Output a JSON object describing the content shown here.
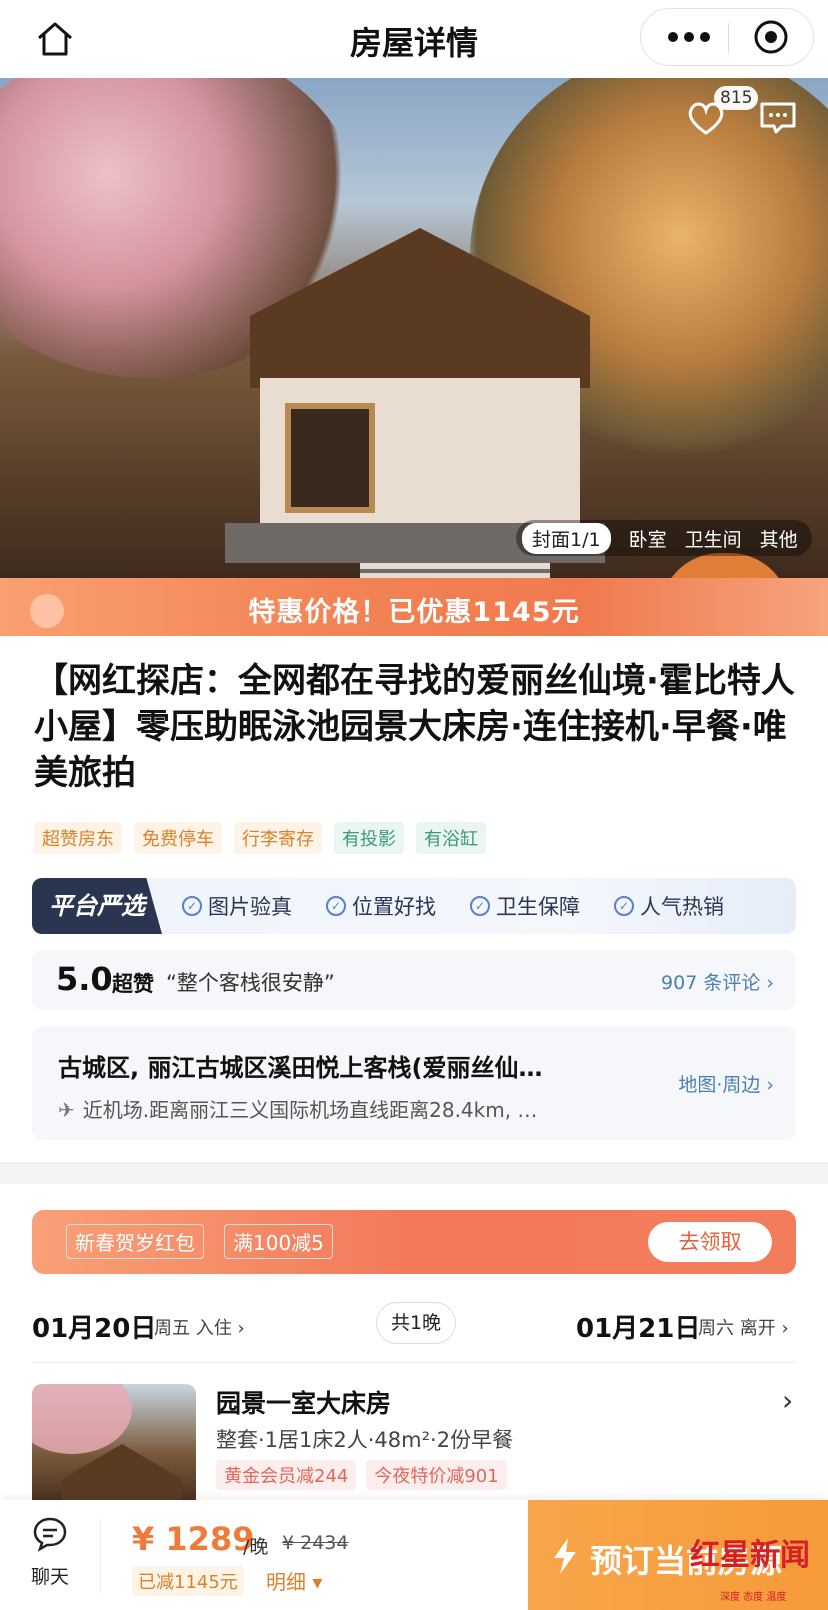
{
  "header": {
    "title": "房屋详情"
  },
  "hero": {
    "favorite_count": "815",
    "image_tabs": [
      "封面1/1",
      "卧室",
      "卫生间",
      "其他"
    ]
  },
  "promo": {
    "text": "特惠价格！已优惠1145元"
  },
  "listing": {
    "title": "【网红探店：全网都在寻找的爱丽丝仙境·霍比特人小屋】零压助眠泳池园景大床房·连住接机·早餐·唯美旅拍",
    "tags": [
      "超赞房东",
      "免费停车",
      "行李寄存",
      "有投影",
      "有浴缸"
    ]
  },
  "platform": {
    "logo": "平台严选",
    "items": [
      "图片验真",
      "位置好找",
      "卫生保障",
      "人气热销"
    ]
  },
  "rating": {
    "score": "5.0",
    "level": "超赞",
    "quote": "“整个客栈很安静”",
    "reviews": "907 条评论 ›"
  },
  "location": {
    "name": "古城区, 丽江古城区溪田悦上客栈(爱丽丝仙…",
    "distance": "近机场.距离丽江三义国际机场直线距离28.4km, …",
    "map_link": "地图·周边 ›"
  },
  "coupon": {
    "name": "新春贺岁红包",
    "rule": "满100减5",
    "claim": "去领取"
  },
  "dates": {
    "checkin_date": "01月20日",
    "checkin_label": "周五 入住 ›",
    "nights": "共1晚",
    "checkout_date": "01月21日",
    "checkout_label": "周六 离开 ›"
  },
  "room": {
    "name": "园景一室大床房",
    "spec": "整套·1居1床2人·48m²·2份早餐",
    "discounts": [
      "黄金会员减244",
      "今夜特价减901"
    ]
  },
  "bottom": {
    "chat_label": "聊天",
    "price": "¥ 1289",
    "per_night": "/晚",
    "original_price": "¥ 2434",
    "saved": "已减1145元",
    "detail": "明细 ▾",
    "book_label": "预订当前房源"
  },
  "watermark": {
    "text": "红星新闻",
    "sub": "深度 态度 温度"
  },
  "colors": {
    "accent": "#f07a3a",
    "promo": "#f38355",
    "link": "#4a7fb0",
    "book": "#f79a3a"
  }
}
